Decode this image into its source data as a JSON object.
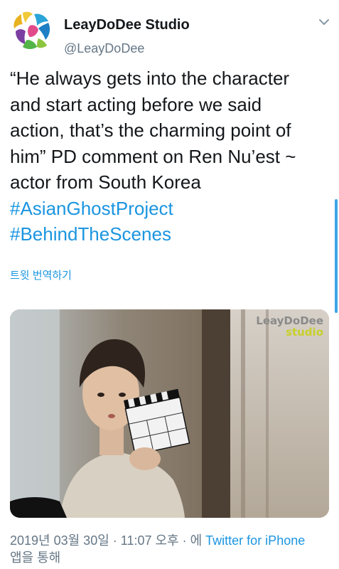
{
  "author": {
    "display_name": "LeayDoDee Studio",
    "handle": "@LeayDoDee",
    "avatar_icon": "colorful-hands-logo"
  },
  "tweet": {
    "lines": [
      "“He always gets into the character",
      "and start acting before we said",
      "action, that’s the charming point of",
      "him” PD comment on Ren Nu’est ~",
      "actor from South Korea"
    ],
    "hashtags": [
      "#AsianGhostProject",
      "#BehindTheScenes"
    ],
    "translate_label": "트윗 번역하기"
  },
  "media": {
    "watermark_line1": "LeayDoDee",
    "watermark_line2": "studio"
  },
  "meta": {
    "timestamp": "2019년 03월 30일 · 11:07 오후 · 에",
    "source": "Twitter for iPhone",
    "via": "앱을 통해"
  },
  "colors": {
    "link": "#1b95e0",
    "secondary": "#657786",
    "text": "#14171a"
  }
}
